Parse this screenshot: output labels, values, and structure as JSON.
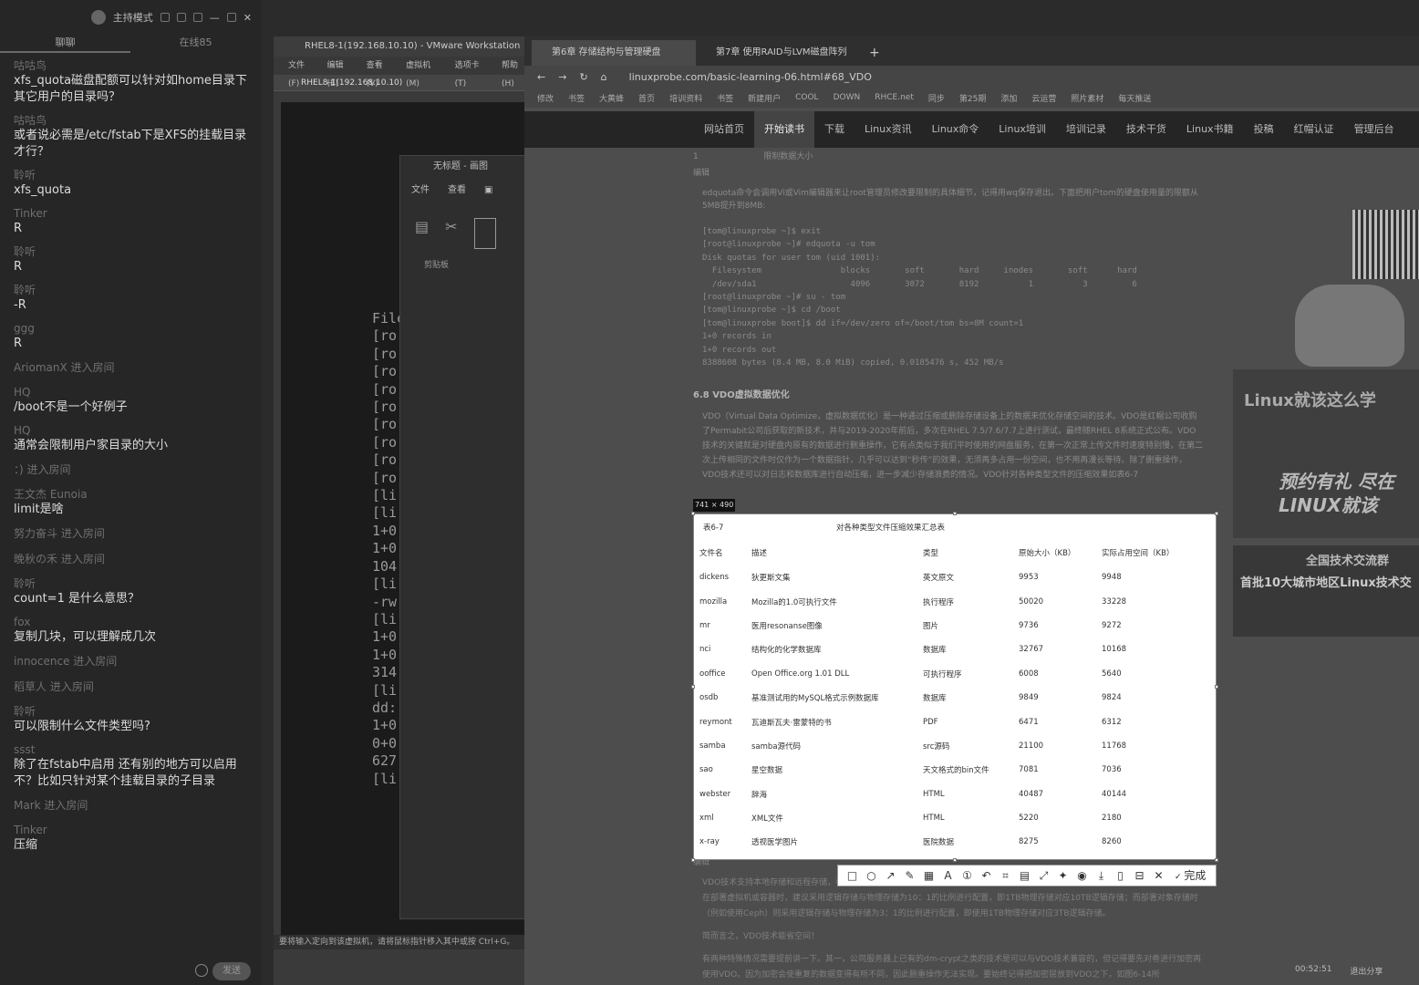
{
  "chat": {
    "mode": "主持模式",
    "tabs": [
      "聊聊",
      "在线85"
    ],
    "messages": [
      {
        "user": "咕咕鸟",
        "text": "xfs_quota磁盘配额可以针对如home目录下其它用户的目录吗？"
      },
      {
        "user": "咕咕鸟",
        "text": "或者说必需是/etc/fstab下是XFS的挂载目录才行？"
      },
      {
        "user": "聆听",
        "text": "xfs_quota"
      },
      {
        "user": "Tinker",
        "text": "R"
      },
      {
        "user": "聆听",
        "text": "R"
      },
      {
        "user": "聆听",
        "text": "-R"
      },
      {
        "user": "ggg",
        "text": "R"
      },
      {
        "sys": "AriomanX 进入房间"
      },
      {
        "user": "HQ",
        "text": "/boot不是一个好例子"
      },
      {
        "user": "HQ",
        "text": "通常会限制用户家目录的大小"
      },
      {
        "sys": "：) 进入房间"
      },
      {
        "user": "王文杰 Eunoia",
        "text": "limit是啥"
      },
      {
        "sys": "努力奋斗 进入房间"
      },
      {
        "sys": "晚秋の禾 进入房间"
      },
      {
        "user": "聆听",
        "text": "count=1 是什么意思？"
      },
      {
        "user": "fox",
        "text": "复制几块，可以理解成几次"
      },
      {
        "sys": "innocence 进入房间"
      },
      {
        "sys": "稻草人 进入房间"
      },
      {
        "user": "聆听",
        "text": "可以限制什么文件类型吗?"
      },
      {
        "user": "ssst",
        "text": "除了在fstab中启用 还有别的地方可以启用不？比如只针对某个挂载目录的子目录"
      },
      {
        "sys": "Mark 进入房间"
      },
      {
        "user": "Tinker",
        "text": "压缩"
      }
    ],
    "send": "发送"
  },
  "vmware": {
    "title": "RHEL8-1(192.168.10.10) - VMware Workstation",
    "menu": [
      "文件(F)",
      "编辑(E)",
      "查看(V)",
      "虚拟机(M)",
      "选项卡(T)",
      "帮助(H)"
    ],
    "tab": "RHEL8-1(192.168.10.10)",
    "terminal": [
      "File",
      "[ro",
      "[ro",
      "[ro",
      "[ro",
      "[ro",
      "[ro",
      "[ro",
      "[ro",
      "[ro",
      "[li",
      "[li",
      "1+0",
      "1+0",
      "104",
      "[li",
      "-rw",
      "[li",
      "1+0",
      "1+0",
      "314",
      "[li",
      "dd:",
      "1+0",
      "0+0",
      "627",
      "[li"
    ],
    "status": "要将输入定向到该虚拟机，请将鼠标指针移入其中或按 Ctrl+G。"
  },
  "paint": {
    "title": "无标题 - 画图",
    "menu": [
      "文件",
      "查看"
    ],
    "clip": "剪贴板"
  },
  "browser": {
    "tabs": [
      "第6章 存储结构与管理硬盘",
      "第7章 使用RAID与LVM磁盘阵列"
    ],
    "url": "linuxprobe.com/basic-learning-06.html#68_VDO",
    "bookmarks": [
      "修改",
      "书签",
      "大黄蜂",
      "首页",
      "培训资料",
      "书签",
      "新建用户",
      "COOL",
      "DOWN",
      "RHCE.net",
      "同步",
      "第25期",
      "添加",
      "云运营",
      "照片素材",
      "每天推送"
    ],
    "nav": [
      "网站首页",
      "开始读书",
      "下载",
      "Linux资讯",
      "Linux命令",
      "Linux培训",
      "培训记录",
      "技术干货",
      "Linux书籍",
      "投稿",
      "红帽认证",
      "管理后台"
    ]
  },
  "article": {
    "top_row": "1                         限制数据大小",
    "edit": "编辑",
    "para1": "edquota命令会调用Vi或Vim编辑器来让root管理员修改要限制的具体细节，记得用wq保存退出。下面把用户tom的硬盘使用量的限额从5MB提升到8MB:",
    "code": "[tom@linuxprobe ~]$ exit\n[root@linuxprobe ~]# edquota -u tom\nDisk quotas for user tom (uid 1001):\n  Filesystem                blocks       soft       hard     inodes       soft      hard\n  /dev/sda1                   4096       3072       8192          1          3         6\n[root@linuxprobe ~]# su - tom\n[tom@linuxprobe ~]$ cd /boot\n[tom@linuxprobe boot]$ dd if=/dev/zero of=/boot/tom bs=8M count=1\n1+0 records in\n1+0 records out\n8388608 bytes (8.4 MB, 8.0 MiB) copied, 0.0185476 s, 452 MB/s",
    "heading": "6.8 VDO虚拟数据优化",
    "para2": "VDO（Virtual Data Optimize，虚拟数据优化）是一种通过压缩或删除存储设备上的数据来优化存储空间的技术。VDO是红帽公司收购了Permabit公司后获取的新技术，并与2019-2020年前后，多次在RHEL 7.5/7.6/7.7上进行测试，最终随RHEL 8系统正式公布。VDO技术的关键就是对硬盘内原有的数据进行删重操作，它有点类似于我们平时使用的网盘服务，在第一次正常上传文件时速度特别慢，在第二次上传相同的文件时仅作为一个数据指针，几乎可以达到“秒传”的效果，无须再多占用一份空间，也不用再漫长等待。除了删重操作，VDO技术还可以对日志和数据库进行自动压缩，进一步减少存储浪费的情况。VDO针对各种类型文件的压缩效果如表6-7",
    "after": "编辑",
    "below1": "VDO技术支持本地存储和远程存储，可以作为本地文件系统、iSCSI或Ceph存储下的附加存储层使用。红帽公司在VDO介绍页面中提到，在部署虚拟机或容器时，建议采用逻辑存储与物理存储为10：1的比例进行配置，即1TB物理存储对应10TB逻辑存储；而部署对象存储时（例如使用Ceph）则采用逻辑存储与物理存储为3：1的比例进行配置，即使用1TB物理存储对应3TB逻辑存储。",
    "below2": "简而言之，VDO技术能省空间！",
    "below3": "有两种特殊情况需要提前讲一下。其一，公司服务器上已有的dm-crypt之类的技术是可以与VDO技术兼容的，但记得要先对卷进行加密再使用VDO。因为加密会使重复的数据变得有所不同，因此删重操作无法实现。要始终记得把加密层放到VDO之下，如图6-14所"
  },
  "selection": {
    "size": "741 × 490",
    "caption_no": "表6-7",
    "caption": "对各种类型文件压缩效果汇总表",
    "columns": [
      "文件名",
      "描述",
      "类型",
      "原始大小（KB）",
      "实际占用空间（KB）"
    ],
    "rows": [
      [
        "dickens",
        "狄更斯文集",
        "英文原文",
        "9953",
        "9948"
      ],
      [
        "mozilla",
        "Mozilla的1.0可执行文件",
        "执行程序",
        "50020",
        "33228"
      ],
      [
        "mr",
        "医用resonanse图像",
        "图片",
        "9736",
        "9272"
      ],
      [
        "nci",
        "结构化的化学数据库",
        "数据库",
        "32767",
        "10168"
      ],
      [
        "ooffice",
        "Open Office.org 1.01 DLL",
        "可执行程序",
        "6008",
        "5640"
      ],
      [
        "osdb",
        "基准测试用的MySQL格式示例数据库",
        "数据库",
        "9849",
        "9824"
      ],
      [
        "reymont",
        "瓦迪斯瓦夫·雷蒙特的书",
        "PDF",
        "6471",
        "6312"
      ],
      [
        "samba",
        "samba源代码",
        "src源码",
        "21100",
        "11768"
      ],
      [
        "sao",
        "星空数据",
        "天文格式的bin文件",
        "7081",
        "7036"
      ],
      [
        "webster",
        "辞海",
        "HTML",
        "40487",
        "40144"
      ],
      [
        "xml",
        "XML文件",
        "HTML",
        "5220",
        "2180"
      ],
      [
        "x-ray",
        "透视医学图片",
        "医院数据",
        "8275",
        "8260"
      ]
    ],
    "done": "完成"
  },
  "ads": {
    "ad1": "Linux就该这么学",
    "ad1b": "预约有礼 尽在LINUX就该",
    "ad2a": "全国技术交流群",
    "ad2b": "首批10大城市地区Linux技术交"
  },
  "status": {
    "time": "00:52:51",
    "share": "退出分享"
  }
}
